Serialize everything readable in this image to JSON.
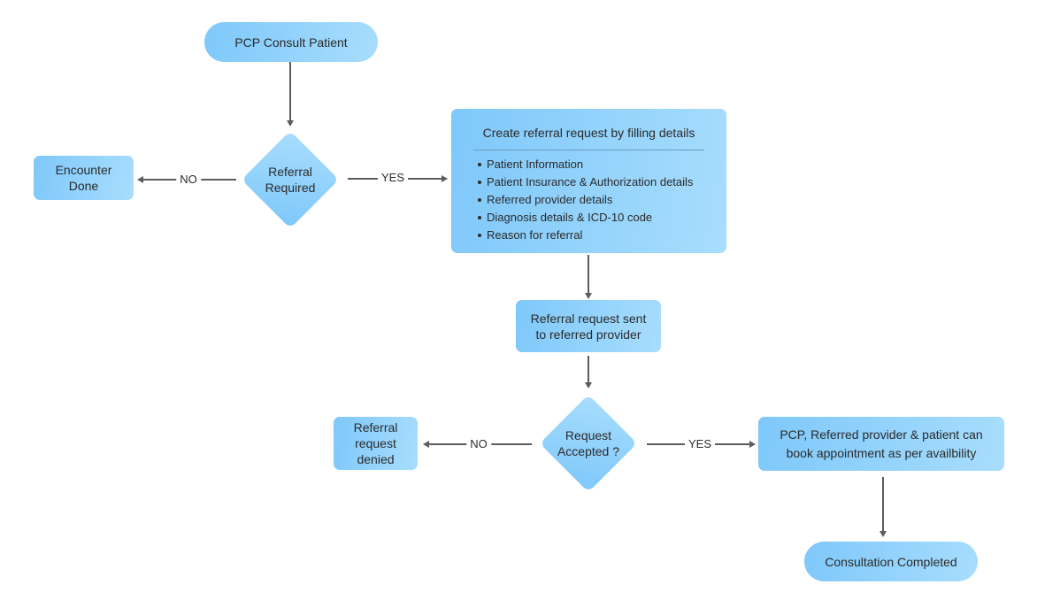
{
  "colors": {
    "node_fill_start": "#7ec8fa",
    "node_fill_end": "#a8ddfd",
    "connector": "#5c5c5c",
    "text": "#2a2a2a"
  },
  "nodes": {
    "start": {
      "label": "PCP Consult Patient",
      "shape": "terminal"
    },
    "decision_referral": {
      "label_line1": "Referral",
      "label_line2": "Required",
      "shape": "decision"
    },
    "encounter_done": {
      "label_line1": "Encounter",
      "label_line2": "Done",
      "shape": "process"
    },
    "create_referral": {
      "title": "Create referral request by filling details",
      "items": [
        "Patient Information",
        "Patient Insurance & Authorization details",
        "Referred provider details",
        "Diagnosis details & ICD-10 code",
        "Reason for referral"
      ],
      "shape": "process"
    },
    "request_sent": {
      "label_line1": "Referral request sent",
      "label_line2": "to referred provider",
      "shape": "process"
    },
    "decision_accepted": {
      "label_line1": "Request",
      "label_line2": "Accepted ?",
      "shape": "decision"
    },
    "request_denied": {
      "label_line1": "Referral",
      "label_line2": "request",
      "label_line3": "denied",
      "shape": "process"
    },
    "book_appointment": {
      "label_line1": "PCP, Referred provider & patient can",
      "label_line2": "book appointment as per availbility",
      "shape": "process"
    },
    "end": {
      "label": "Consultation Completed",
      "shape": "terminal"
    }
  },
  "edges": {
    "referral_no": "NO",
    "referral_yes": "YES",
    "accepted_no": "NO",
    "accepted_yes": "YES"
  }
}
